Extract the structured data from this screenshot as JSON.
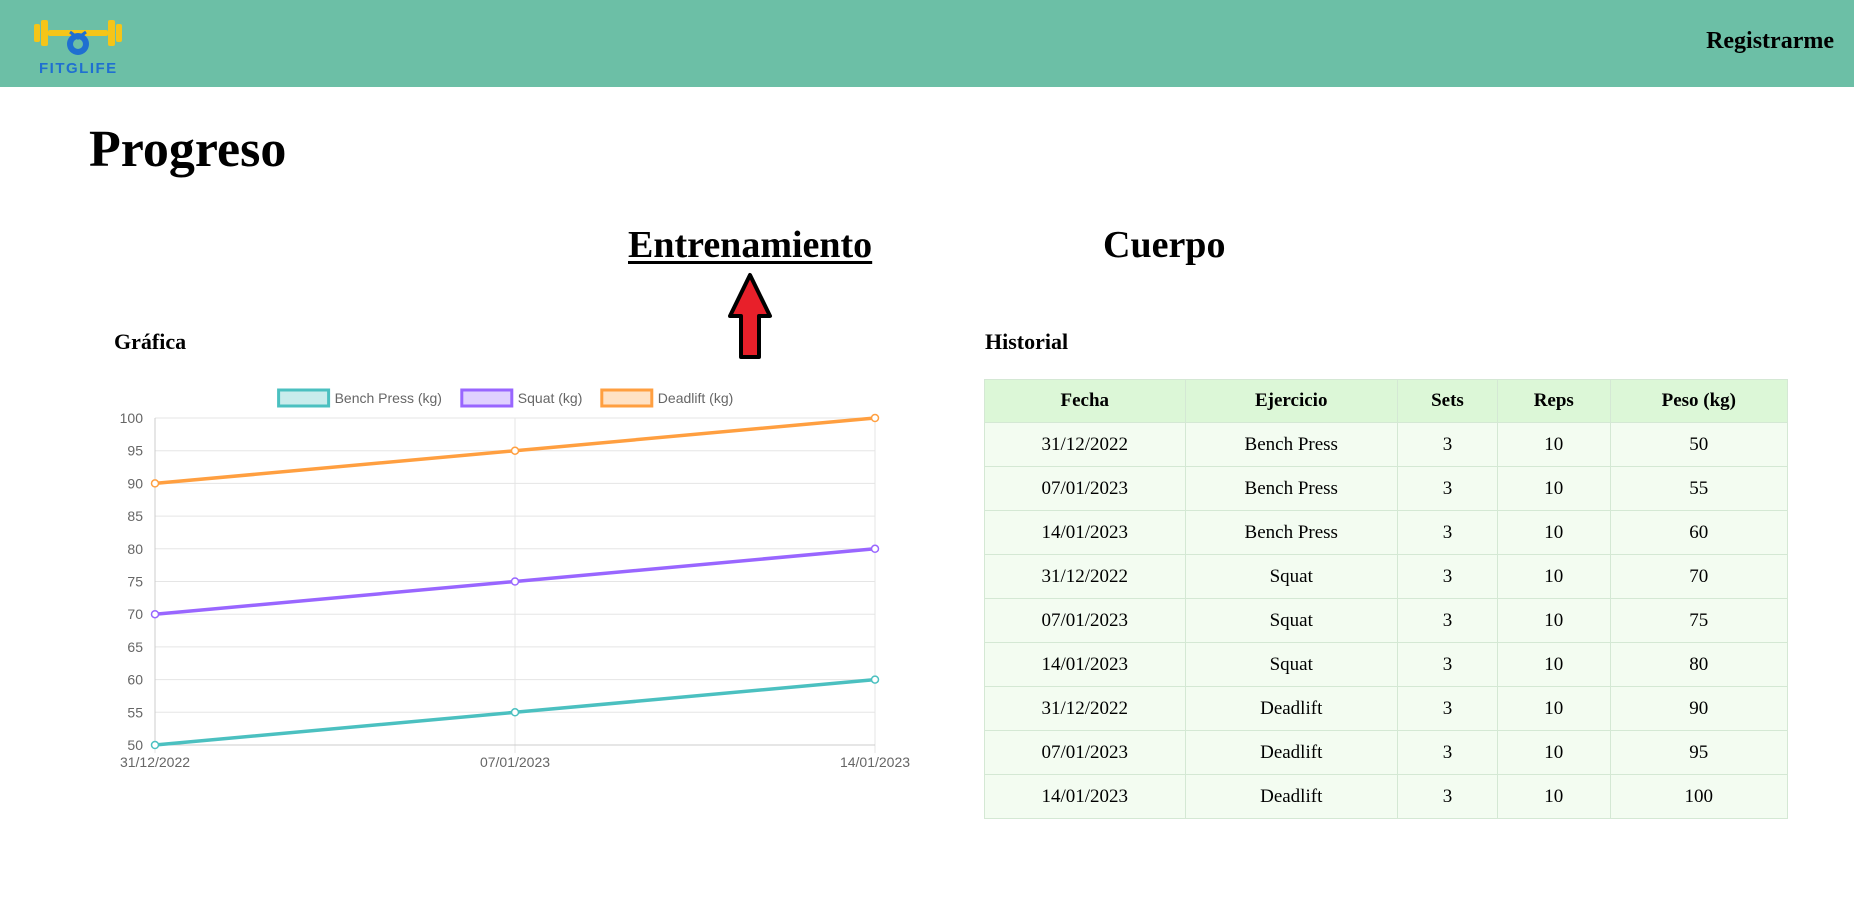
{
  "navbar": {
    "brand": "FITGLIFE",
    "register_label": "Registrarme",
    "color": "#6cbfa6"
  },
  "page": {
    "title": "Progreso"
  },
  "tabs": [
    {
      "label": "Entrenamiento",
      "active": true
    },
    {
      "label": "Cuerpo",
      "active": false
    }
  ],
  "chart_section": {
    "title": "Gráfica"
  },
  "history_section": {
    "title": "Historial"
  },
  "chart_data": {
    "type": "line",
    "x": [
      "31/12/2022",
      "07/01/2023",
      "14/01/2023"
    ],
    "series": [
      {
        "name": "Bench Press (kg)",
        "values": [
          50,
          55,
          60
        ],
        "color": "#4bc0c0"
      },
      {
        "name": "Squat (kg)",
        "values": [
          70,
          75,
          80
        ],
        "color": "#9966ff"
      },
      {
        "name": "Deadlift (kg)",
        "values": [
          90,
          95,
          100
        ],
        "color": "#ff9f40"
      }
    ],
    "ylim": [
      50,
      100
    ],
    "yticks": [
      "100",
      "95",
      "90",
      "85",
      "80",
      "75",
      "70",
      "65",
      "60",
      "55",
      "50"
    ],
    "grid": true,
    "legend": "top"
  },
  "table": {
    "headers": [
      "Fecha",
      "Ejercicio",
      "Sets",
      "Reps",
      "Peso (kg)"
    ],
    "rows": [
      [
        "31/12/2022",
        "Bench Press",
        "3",
        "10",
        "50"
      ],
      [
        "07/01/2023",
        "Bench Press",
        "3",
        "10",
        "55"
      ],
      [
        "14/01/2023",
        "Bench Press",
        "3",
        "10",
        "60"
      ],
      [
        "31/12/2022",
        "Squat",
        "3",
        "10",
        "70"
      ],
      [
        "07/01/2023",
        "Squat",
        "3",
        "10",
        "75"
      ],
      [
        "14/01/2023",
        "Squat",
        "3",
        "10",
        "80"
      ],
      [
        "31/12/2022",
        "Deadlift",
        "3",
        "10",
        "90"
      ],
      [
        "07/01/2023",
        "Deadlift",
        "3",
        "10",
        "95"
      ],
      [
        "14/01/2023",
        "Deadlift",
        "3",
        "10",
        "100"
      ]
    ]
  },
  "icons": {
    "logo": "dumbbell-logo-icon",
    "pointer": "red-arrow-up-icon"
  }
}
